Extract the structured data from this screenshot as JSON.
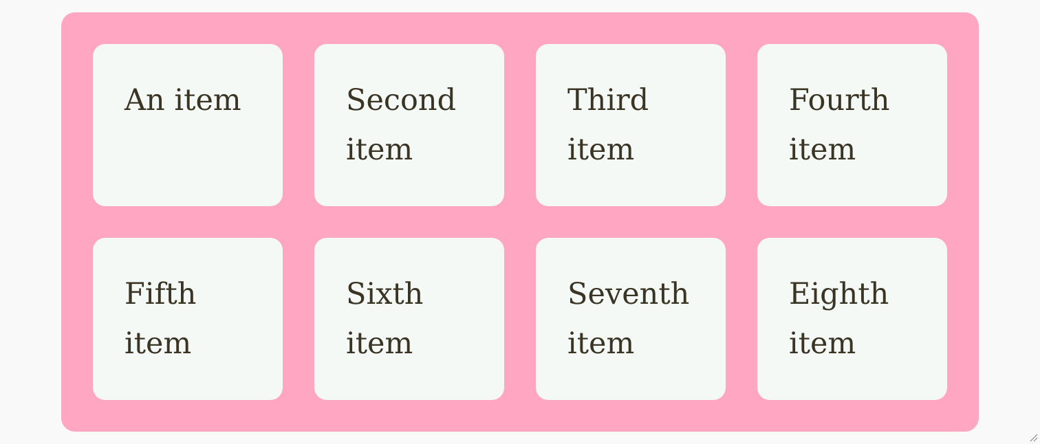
{
  "grid": {
    "items": [
      {
        "label": "An item"
      },
      {
        "label": "Second item"
      },
      {
        "label": "Third item"
      },
      {
        "label": "Fourth item"
      },
      {
        "label": "Fifth item"
      },
      {
        "label": "Sixth item"
      },
      {
        "label": "Seventh item"
      },
      {
        "label": "Eighth item"
      }
    ]
  },
  "colors": {
    "container_background": "#ffa6c2",
    "item_background": "#f5f9f6",
    "text": "#3a3424",
    "page_background": "#f9f9f9"
  },
  "icons": {
    "resize_handle": "resize-grip-icon"
  }
}
